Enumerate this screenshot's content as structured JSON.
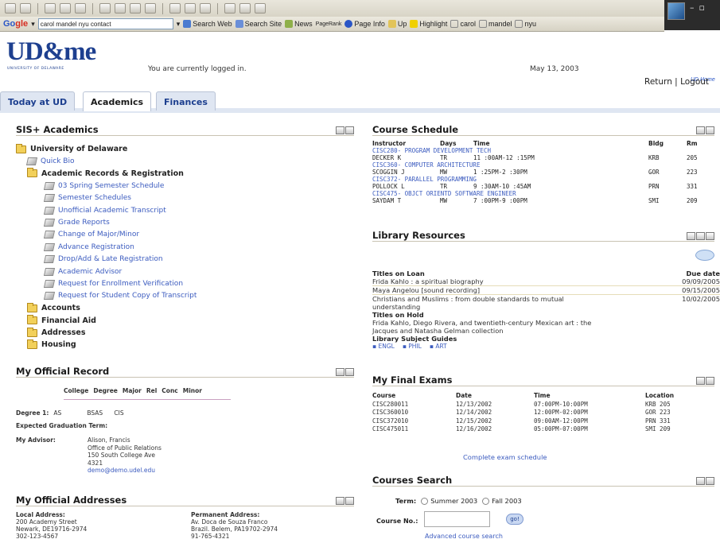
{
  "browser": {
    "search_value": "carol mandel nyu contact",
    "toolbar": {
      "search_web": "Search Web",
      "search_site": "Search Site",
      "news": "News",
      "pagerank": "PageRank",
      "page_info": "Page Info",
      "up": "Up",
      "highlight": "Highlight",
      "hl_terms": [
        "carol",
        "mandel",
        "nyu"
      ]
    }
  },
  "header": {
    "logo_text": "UD&me",
    "logo_sub": "UNIVERSITY OF DELAWARE",
    "logged_in": "You are currently logged in.",
    "date": "May 13, 2003",
    "ud_home": "UD Home",
    "return": "Return",
    "logout": "Logout"
  },
  "tabs": [
    "Today at UD",
    "Academics",
    "Finances"
  ],
  "sis": {
    "title": "SIS+ Academics",
    "root": "University of Delaware",
    "quick_bio": "Quick Bio",
    "records": "Academic Records & Registration",
    "links": [
      "03 Spring Semester Schedule",
      "Semester Schedules",
      "Unofficial Academic Transcript",
      "Grade Reports",
      "Change of Major/Minor",
      "Advance Registration",
      "Drop/Add & Late Registration",
      "Academic Advisor",
      "Request for Enrollment Verification",
      "Request for Student Copy of Transcript"
    ],
    "folders": [
      "Accounts",
      "Financial Aid",
      "Addresses",
      "Housing"
    ]
  },
  "record": {
    "title": "My Official Record",
    "cols": [
      "College",
      "Degree",
      "Major",
      "Rel",
      "Conc",
      "Minor"
    ],
    "degree_label": "Degree 1:",
    "degree_values": [
      "AS",
      "BSAS",
      "CIS"
    ],
    "grad_label": "Expected Graduation Term:",
    "advisor_label": "My Advisor:",
    "advisor_lines": [
      "Alison, Francis",
      "Office of Public Relations",
      "150 South College Ave",
      "4321"
    ],
    "advisor_email": "demo@demo.udel.edu"
  },
  "addresses": {
    "title": "My Official Addresses",
    "local_label": "Local Address:",
    "local_lines": [
      "200 Academy Street",
      "Newark, DE19716-2974",
      "302-123-4567"
    ],
    "perm_label": "Permanent Address:",
    "perm_lines": [
      "Av. Doca de Souza Franco",
      "Brazil. Belem, PA19702-2974",
      "91-765-4321"
    ]
  },
  "schedule": {
    "title": "Course Schedule",
    "headers": [
      "Instructor",
      "Days",
      "Time",
      "Bldg",
      "Rm"
    ],
    "courses": [
      {
        "name": "CISC280- PROGRAM DEVELOPMENT TECH",
        "instructor": "DECKER K",
        "days": "TR",
        "time": "11 :00AM-12 :15PM",
        "bldg": "KRB",
        "rm": "205"
      },
      {
        "name": "CISC360- COMPUTER ARCHITECTURE",
        "instructor": "SCOGGIN J",
        "days": "MW",
        "time": "1 :25PM-2 :30PM",
        "bldg": "GOR",
        "rm": "223"
      },
      {
        "name": "CISC372- PARALLEL PROGRAMMING",
        "instructor": "POLLOCK L",
        "days": "TR",
        "time": "9 :30AM-10 :45AM",
        "bldg": "PRN",
        "rm": "331"
      },
      {
        "name": "CISC475- OBJCT ORIENTD SOFTWARE ENGINEER",
        "instructor": "SAYDAM T",
        "days": "MW",
        "time": "7 :00PM-9 :00PM",
        "bldg": "SMI",
        "rm": "209"
      }
    ]
  },
  "library": {
    "title": "Library Resources",
    "loan_label": "Titles on Loan",
    "due_label": "Due date",
    "loans": [
      {
        "title": "Frida Kahlo : a spiritual biography",
        "due": "09/09/2005"
      },
      {
        "title": "Maya Angelou [sound recording]",
        "due": "09/15/2005"
      },
      {
        "title": "Christians and Muslims : from double standards to mutual",
        "due": "10/02/2005"
      }
    ],
    "loan_cont": "understanding",
    "hold_label": "Titles on Hold",
    "holds": [
      "Frida Kahlo, Diego Rivera, and twentieth-century Mexican art : the",
      "Jacques and Natasha Gelman collection"
    ],
    "guides_label": "Library Subject Guides",
    "guides": [
      "ENGL",
      "PHIL",
      "ART"
    ]
  },
  "exams": {
    "title": "My Final Exams",
    "headers": [
      "Course",
      "Date",
      "Time",
      "Location"
    ],
    "rows": [
      [
        "CISC280011",
        "12/13/2002",
        "07:00PM-10:00PM",
        "KRB 205"
      ],
      [
        "CISC360010",
        "12/14/2002",
        "12:00PM-02:00PM",
        "GOR 223"
      ],
      [
        "CISC372010",
        "12/15/2002",
        "09:00AM-12:00PM",
        "PRN 331"
      ],
      [
        "CISC475011",
        "12/16/2002",
        "05:00PM-07:00PM",
        "SMI 209"
      ]
    ],
    "complete": "Complete exam schedule"
  },
  "search": {
    "title": "Courses Search",
    "term_label": "Term:",
    "terms": [
      "Summer 2003",
      "Fall 2003"
    ],
    "course_label": "Course No.:",
    "go": "go!",
    "advanced": "Advanced course search"
  }
}
